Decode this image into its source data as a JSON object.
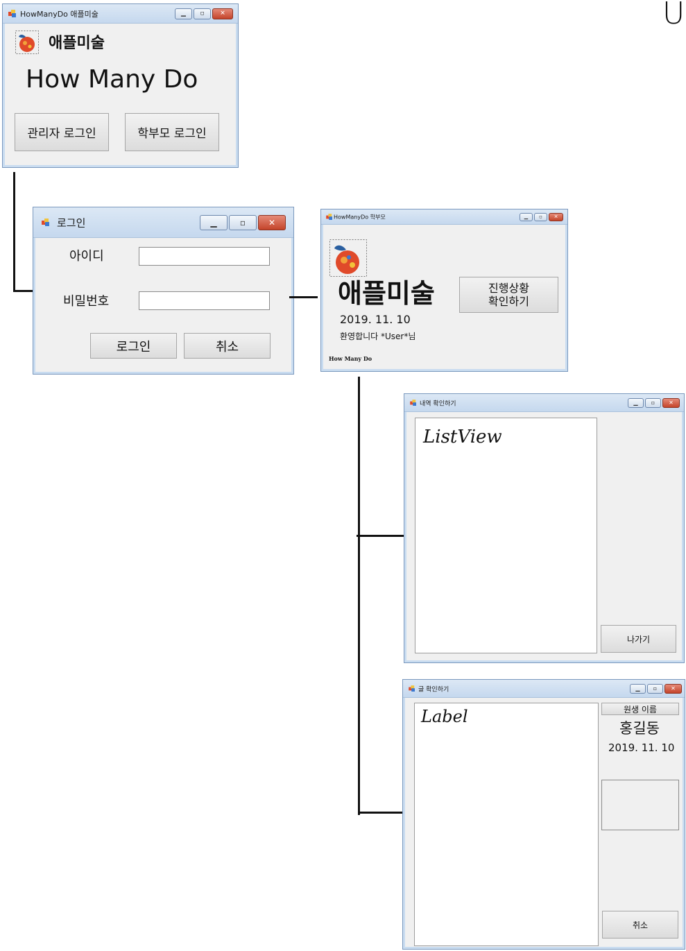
{
  "corner_mark": "U",
  "win_main": {
    "title": "HowManyDo 애플미술",
    "brand": "애플미술",
    "heading": "How Many Do",
    "btn_admin": "관리자 로그인",
    "btn_parent": "학부모 로그인"
  },
  "win_login": {
    "title": "로그인",
    "id_label": "아이디",
    "pw_label": "비밀번호",
    "login_btn": "로그인",
    "cancel_btn": "취소"
  },
  "win_parent": {
    "title": "HowManyDo 학부모",
    "brand": "애플미술",
    "progress_btn_line1": "진행상황",
    "progress_btn_line2": "확인하기",
    "date": "2019. 11. 10",
    "welcome": "환영합니다 *User*님",
    "footer": "How Many Do"
  },
  "win_history": {
    "title": "내역 확인하기",
    "listview_note": "ListView",
    "exit_btn": "나가기"
  },
  "win_post": {
    "title": "글 확인하기",
    "label_note": "Label",
    "student_name_header": "원생 이름",
    "student_name": "홍길동",
    "date": "2019. 11. 10",
    "cancel_btn": "취소"
  },
  "colors": {
    "window_bg": "#f0f0f0",
    "titlebar": "#c5d8ee",
    "close_button": "#c4442a",
    "apple_red": "#e04a2a",
    "leaf_blue": "#2a5fa0"
  }
}
